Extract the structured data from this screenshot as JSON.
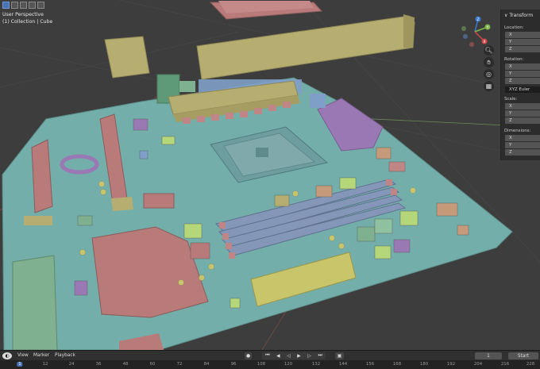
{
  "viewport": {
    "perspective_label": "User Perspective",
    "collection_label": "(1) Collection | Cube"
  },
  "gizmo": {
    "axes": [
      "Z",
      "Y",
      "X"
    ]
  },
  "nav_icons": [
    "zoom-icon",
    "hand-icon",
    "camera-icon",
    "grid-icon"
  ],
  "panel": {
    "title": "Transform",
    "location_label": "Location:",
    "rotation_label": "Rotation:",
    "rotation_mode": "XYZ Euler",
    "scale_label": "Scale:",
    "dimensions_label": "Dimensions:",
    "axes": [
      "X",
      "Y",
      "Z"
    ]
  },
  "timeline": {
    "menu": [
      "View",
      "Marker",
      "Playback"
    ],
    "current_frame": "1",
    "start_label": "Start",
    "ruler": [
      "1",
      "12",
      "24",
      "36",
      "48",
      "60",
      "72",
      "84",
      "96",
      "108",
      "120",
      "132",
      "144",
      "156",
      "168",
      "180",
      "192",
      "204",
      "216",
      "228"
    ]
  },
  "colors": {
    "board": "#73aeaa",
    "pink": "#b97a7a",
    "olive": "#b6ad70",
    "purple": "#9a78b3",
    "green": "#7fb090",
    "blue": "#7f9ec8"
  }
}
